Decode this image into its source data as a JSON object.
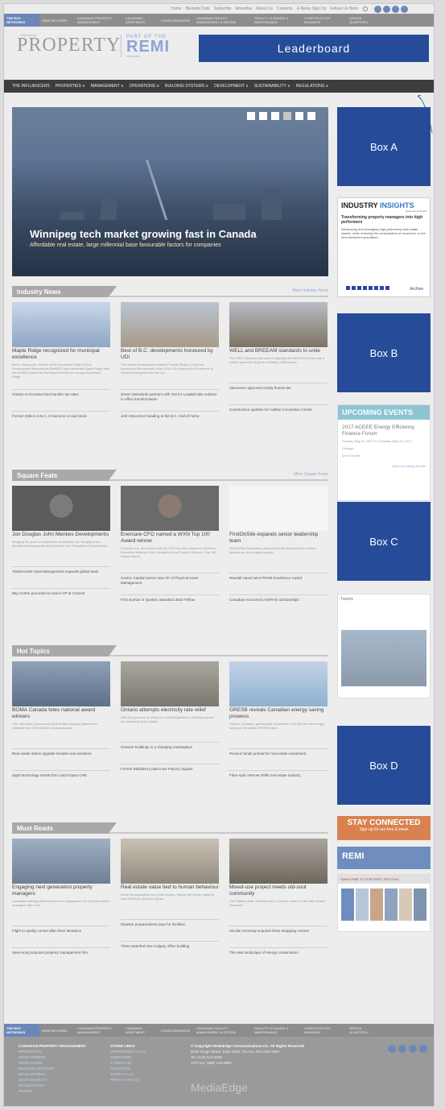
{
  "topbar": {
    "links": [
      "Home",
      "Bisnode Dubl",
      "Subscribe",
      "Advertise",
      "About Us",
      "Contacts",
      "E-News Sign Up",
      "Follow Us Here:"
    ]
  },
  "network_bar": [
    "THE BOX NETWORKS",
    "REMI NETWORK",
    "CANADIAN PROPERTY MANAGEMENT",
    "CANADIAN APARTMENT",
    "CONDO BUSINESS",
    "CANADIAN FACILITY MANAGEMENT & DESIGN",
    "FACILITY CLEANING & MAINTENANCE",
    "CONSTRUCTION BUSINESS",
    "DESIGN QUARTERLY"
  ],
  "header": {
    "logo": "PROPERTY",
    "logo_sub": "CANADIAN",
    "remi_part": "PART OF THE",
    "remi": "REMI",
    "remi_url": "remi.com",
    "leaderboard": "Leaderboard"
  },
  "nav": [
    "THE INFLUENCERS",
    "PROPERTIES ∨",
    "MANAGEMENT ∨",
    "OPERATIONS ∨",
    "BUILDING SYSTEMS ∨",
    "DEVELOPMENT ∨",
    "SUSTAINABILITY ∨",
    "REGULATIONS ∨"
  ],
  "hero": {
    "title": "Winnipeg tech market growing fast in Canada",
    "subtitle": "Affordable real estate, large millennial base favourable factors for companies"
  },
  "industry_news": {
    "title": "Industry News",
    "more": "More Industry News",
    "articles": [
      {
        "headline": "Maple Ridge recognized for municipal excellence",
        "excerpt": "Metro Vancouver: District of the Economic Urban Forum Development Association (ReMDP) has presented Maple Ridge with the ReMDP Award for Municipal Excellence recognizing Maple Ridge.",
        "more": [
          "Ontario to increase land transfer tax rates",
          "Former Zellers in B.C. to become U-Haul store"
        ]
      },
      {
        "headline": "Best of B.C. developments honoured by UDI",
        "excerpt": "The Urban Development Institute Pacific Region (UDI) has announced the winners of the 2016 UDI Awards for Excellence in Urban Development for the top...",
        "more": [
          "Green Standards partners with GM for LoopEd take solution to office transformation",
          "John McLernon heading to the B.C. Hall of Fame"
        ]
      },
      {
        "headline": "WELL and BREEAM standards to unite",
        "excerpt": "The WELL Building Standard is aligning with BREEAM to provide a unified approach to green building certifications.",
        "more": [
          "Vancouver approves empty homes tax",
          "Construction updates for Halifax Convention Centre"
        ]
      }
    ]
  },
  "square_feats": {
    "title": "Square Feats",
    "more": "More Square Feats",
    "articles": [
      {
        "headline": "Jon Douglas John Menkes Developments",
        "excerpt": "Bringing 30 years of experience at Menkes, Jon Douglas joins Menkes Developments as Executive Vice President of Commercial.",
        "more": [
          "Timbercreek Asset Management expands global team",
          "Bay Centre promoted to senior VP at Cossort"
        ]
      },
      {
        "headline": "Enercare CFO named a WXN Top 100 Award winner",
        "excerpt": "Enercare Inc. announced that its CFO has been named a Women's Executive Network 2016 Canada's Most Powerful Women: Top 100 Award winner.",
        "more": [
          "Centric Capital names new VP of Physical Asset Management",
          "First woman in Quebec awarded LEED Fellow"
        ]
      },
      {
        "headline": "FirstOnSite expands senior leadership team",
        "excerpt": "FirstOnSite Restoration announced the appointment of senior leaders as the company grows.",
        "more": [
          "Randall Heard wins PRSM Excellence Award",
          "Canadian economist ASHRAE scholarships"
        ]
      }
    ]
  },
  "hot_topics": {
    "title": "Hot Topics",
    "articles": [
      {
        "headline": "BOMA Canada fetes national award winners",
        "excerpt": "The Canadian Commercial Real Estate industry gathered to celebrate the 2016 BOMA Canada Awards.",
        "more": [
          "Real estate status upgrade heralds new investors",
          "Eight technology trends that could impact CRE"
        ]
      },
      {
        "headline": "Ontario attempts electricity rate relief",
        "excerpt": "With the province of Ontario's Global Adjustment, building owners are watching rates closely.",
        "more": [
          "Greener buildings in a changing marketplace",
          "Former Blackberry plant now Factory Square"
        ]
      },
      {
        "headline": "GRESB reveals Canadian energy saving prowess",
        "excerpt": "Sixteen Canadian participants recorded a 1.5% like-for-like energy saving in the latest GRESB report.",
        "more": [
          "Pension funds primed for real estate investment",
          "Fibre-optic internet shifts real estate industry"
        ]
      }
    ]
  },
  "must_reads": {
    "title": "Must Reads",
    "articles": [
      {
        "headline": "Engaging next generation property managers",
        "excerpt": "Canadian building staff require more engagement as next generation managers take over.",
        "more": [
          "Flight to quality comes after three iterations",
          "Siew Hong acquires property management firm"
        ]
      },
      {
        "headline": "Real estate value tied to human behaviour",
        "excerpt": "While demographics are prime factors, human behaviour patterns also influence property values.",
        "more": [
          "Disaster preparedness pays for facilities",
          "Three awarded new Calgary office building"
        ]
      },
      {
        "headline": "Mixed-use project meets old-soul community",
        "excerpt": "The Hillside wide development in Quebec comes to life with historic character.",
        "more": [
          "Sinclair Kennedy acquires three shopping centres",
          "The new landscape of energy conservation"
        ]
      }
    ]
  },
  "sidebar": {
    "box_a": "Box A",
    "box_b": "Box B",
    "box_c": "Box C",
    "box_d": "Box D",
    "insights": {
      "title1": "INDUSTRY",
      "title2": "INSIGHTS",
      "sponsored": "Sponsored Content",
      "headline": "Transforming property managers into high performers",
      "text": "Developing and managing high-performing real estate assets, while reducing the consumption of resources, is the new standard expectation.",
      "archive": "Archive"
    },
    "events": {
      "title": "UPCOMING EVENTS",
      "event_title": "2017 ACEEE Energy Efficiency Finance Forum",
      "event_date": "Sunday, May 21, 2017 to Tuesday, May 23, 2017",
      "event_loc": "Chicago",
      "event_more": "More Details",
      "more": "More Upcoming Events"
    },
    "tweets": "Tweets",
    "stay": {
      "title": "STAY CONNECTED",
      "sub": "Sign up for our free E-news"
    },
    "remi_ad": "REMI",
    "subscribe": "SUBSCRIBE TO OUR PRINT EDITIONS"
  },
  "footer": {
    "col1_head": "CANADIAN PROPERTY MANAGEMENT",
    "col1_links": [
      "PROPERTIES",
      "DEVELOPMENT",
      "OPERATIONS",
      "BUILDING SYSTEMS",
      "DEVELOPMENT",
      "SUSTAINABILITY",
      "REGULATIONS",
      "PEOPLE"
    ],
    "col2_head": "OTHER LINKS",
    "col2_links": [
      "SPONSORED CLASS",
      "SUBSCRIBE",
      "E-NEWS FIN",
      "ADVERTISE",
      "CONTACT US",
      "PRIVACY POLICY"
    ],
    "copyright": "© Copyright MediaEdge Communications Inc. All Rights Reserved",
    "address": "5045 Yonge Street, Suite 1000, Toronto, ON, M2N 2M8",
    "tel": "Tel: (416) 512-8186",
    "tollfree": "Toll Free: (866) 216-0860",
    "brand": "MediaEdge"
  }
}
